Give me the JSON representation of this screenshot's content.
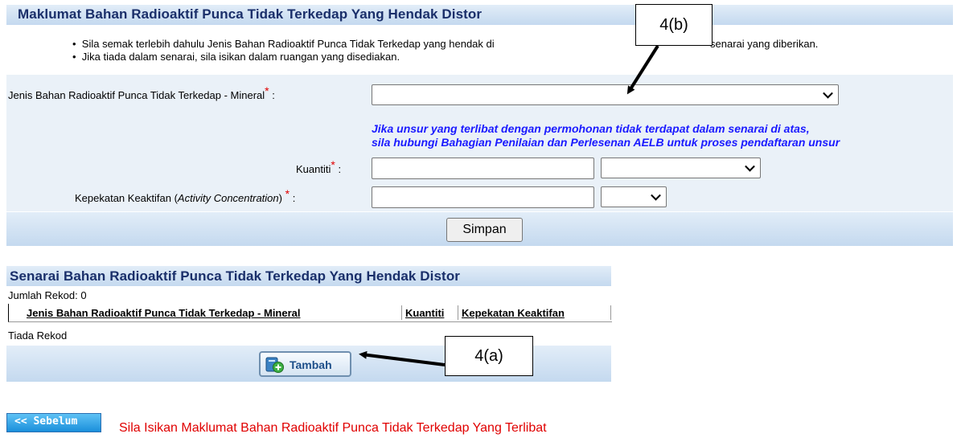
{
  "form_section": {
    "title": "Maklumat Bahan Radioaktif Punca Tidak Terkedap Yang Hendak Distor",
    "instructions": [
      "Sila semak terlebih dahulu Jenis Bahan Radioaktif Punca Tidak Terkedap yang hendak di",
      "senarai yang diberikan.",
      "Jika tiada dalam senarai, sila isikan dalam ruangan yang disediakan."
    ],
    "jenis_label": "Jenis Bahan Radioaktif Punca Tidak Terkedap - Mineral",
    "jenis_value": "",
    "note_line1": "Jika unsur yang terlibat dengan permohonan tidak terdapat dalam senarai di atas,",
    "note_line2": "sila hubungi Bahagian Penilaian dan Perlesenan AELB untuk proses pendaftaran unsur",
    "kuantiti_label": "Kuantiti",
    "kuantiti_value": "",
    "kuantiti_unit": "",
    "kepekatan_label_prefix": "Kepekatan Keaktifan (",
    "kepekatan_label_italic": "Activity Concentration",
    "kepekatan_label_suffix": ")",
    "kepekatan_value": "",
    "kepekatan_unit": "",
    "required_mark": "*",
    "colon": ":",
    "save_label": "Simpan"
  },
  "list_section": {
    "title": "Senarai Bahan Radioaktif Punca Tidak Terkedap Yang Hendak Distor",
    "record_count": "Jumlah Rekod: 0",
    "columns": [
      "Jenis Bahan Radioaktif Punca Tidak Terkedap - Mineral",
      "Kuantiti",
      "Kepekatan Keaktifan"
    ],
    "empty_text": "Tiada Rekod",
    "add_label": "Tambah"
  },
  "footer": {
    "back_label": "<< Sebelum",
    "message": "Sila Isikan Maklumat Bahan Radioaktif Punca Tidak Terkedap Yang Terlibat"
  },
  "annotations": {
    "callout_a": "4(a)",
    "callout_b": "4(b)"
  },
  "colors": {
    "title": "#1a2f6a",
    "note": "#1a1aff",
    "required": "#e00000",
    "footer_message": "#e00000"
  }
}
